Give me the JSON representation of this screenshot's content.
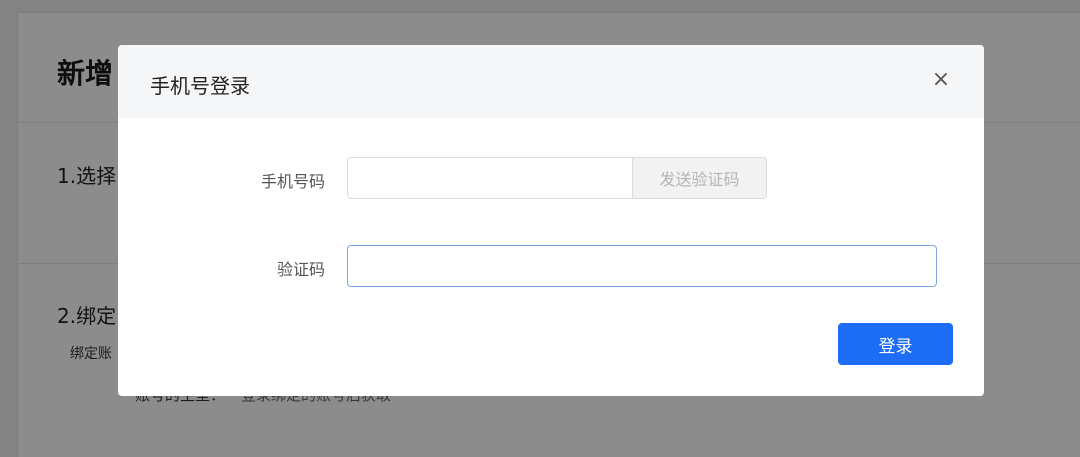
{
  "background": {
    "title": "新增",
    "step1": "1.选择",
    "step2": "2.绑定",
    "step2_desc": "绑定账",
    "account_label": "账号的主室：",
    "account_value": "登录绑定的账号后获取"
  },
  "modal": {
    "title": "手机号登录",
    "close_symbol": "×",
    "phone": {
      "label": "手机号码",
      "value": "",
      "placeholder": "",
      "send_code_label": "发送验证码"
    },
    "code": {
      "label": "验证码",
      "value": "",
      "placeholder": ""
    },
    "login_label": "登录"
  },
  "colors": {
    "primary": "#1d6cf5",
    "overlay": "rgba(0,0,0,0.45)",
    "header_bg": "#f5f6f8",
    "focus_border": "#7ea6e6"
  }
}
